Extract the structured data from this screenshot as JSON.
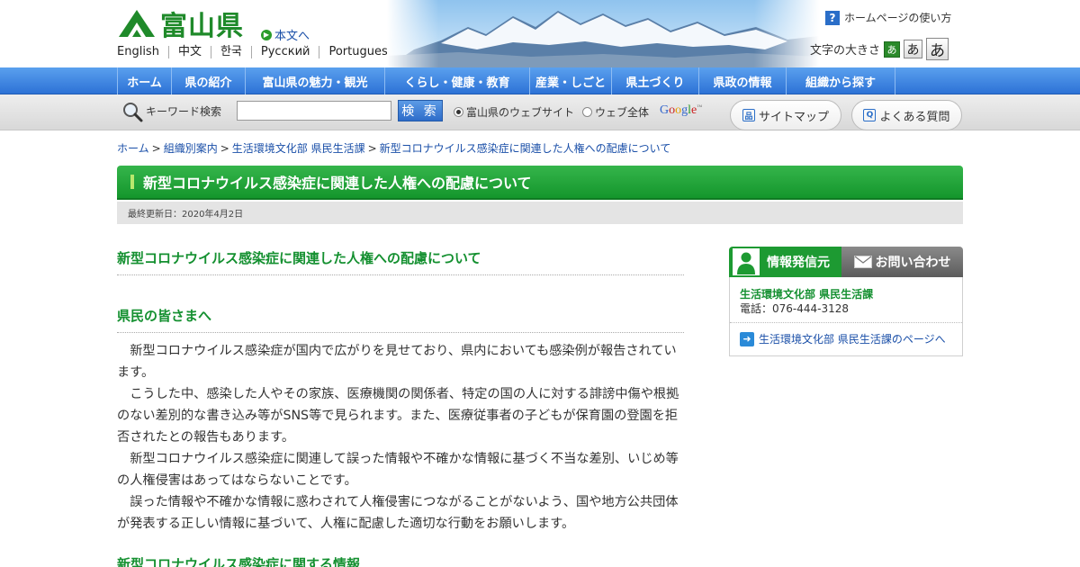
{
  "header": {
    "logo_text": "富山県",
    "skip_link": "本文へ",
    "languages": [
      "English",
      "中文",
      "한국",
      "Русский",
      "Portugues"
    ],
    "help_link": "ホームページの使い方",
    "font_size_label": "文字の大きさ",
    "font_size_buttons": [
      "あ",
      "あ",
      "あ"
    ]
  },
  "nav": {
    "items": [
      "ホーム",
      "県の紹介",
      "富山県の魅力・観光",
      "くらし・健康・教育",
      "産業・しごと",
      "県土づくり",
      "県政の情報",
      "組織から探す"
    ]
  },
  "search": {
    "label": "キーワード検索",
    "input_value": "",
    "button_label": "検 索",
    "option_site": "富山県のウェブサイト",
    "option_web": "ウェブ全体",
    "selected_option": "富山県のウェブサイト",
    "google": "Google",
    "sitemap_label": "サイトマップ",
    "faq_label": "よくある質問"
  },
  "breadcrumb": [
    "ホーム",
    "組織別案内",
    "生活環境文化部 県民生活課",
    "新型コロナウイルス感染症に関連した人権への配慮について"
  ],
  "page": {
    "title": "新型コロナウイルス感染症に関連した人権への配慮について",
    "updated": "最終更新日：2020年4月2日",
    "main_heading": "新型コロナウイルス感染症に関連した人権への配慮について",
    "sub_heading": "県民の皆さまへ",
    "paragraphs": [
      "新型コロナウイルス感染症が国内で広がりを見せており、県内においても感染例が報告されています。",
      "こうした中、感染した人やその家族、医療機関の関係者、特定の国の人に対する誹謗中傷や根拠のない差別的な書き込み等がSNS等で見られます。また、医療従事者の子どもが保育園の登園を拒否されたとの報告もあります。",
      "新型コロナウイルス感染症に関連して誤った情報や不確かな情報に基づく不当な差別、いじめ等の人権侵害はあってはならないことです。",
      "誤った情報や不確かな情報に惑わされて人権侵害につながることがないよう、国や地方公共団体が発表する正しい情報に基づいて、人権に配慮した適切な行動をお願いします。"
    ],
    "next_heading": "新型コロナウイルス感染症に関する情報"
  },
  "sidebar": {
    "tab_info": "情報発信元",
    "tab_contact": "お問い合わせ",
    "dept_name": "生活環境文化部 県民生活課",
    "dept_tel": "電話：076-444-3128",
    "dept_link": "生活環境文化部 県民生活課のページへ"
  },
  "colors": {
    "accent_green": "#1d9a32",
    "nav_blue": "#2d72d6",
    "link_blue": "#1a4fa8"
  }
}
